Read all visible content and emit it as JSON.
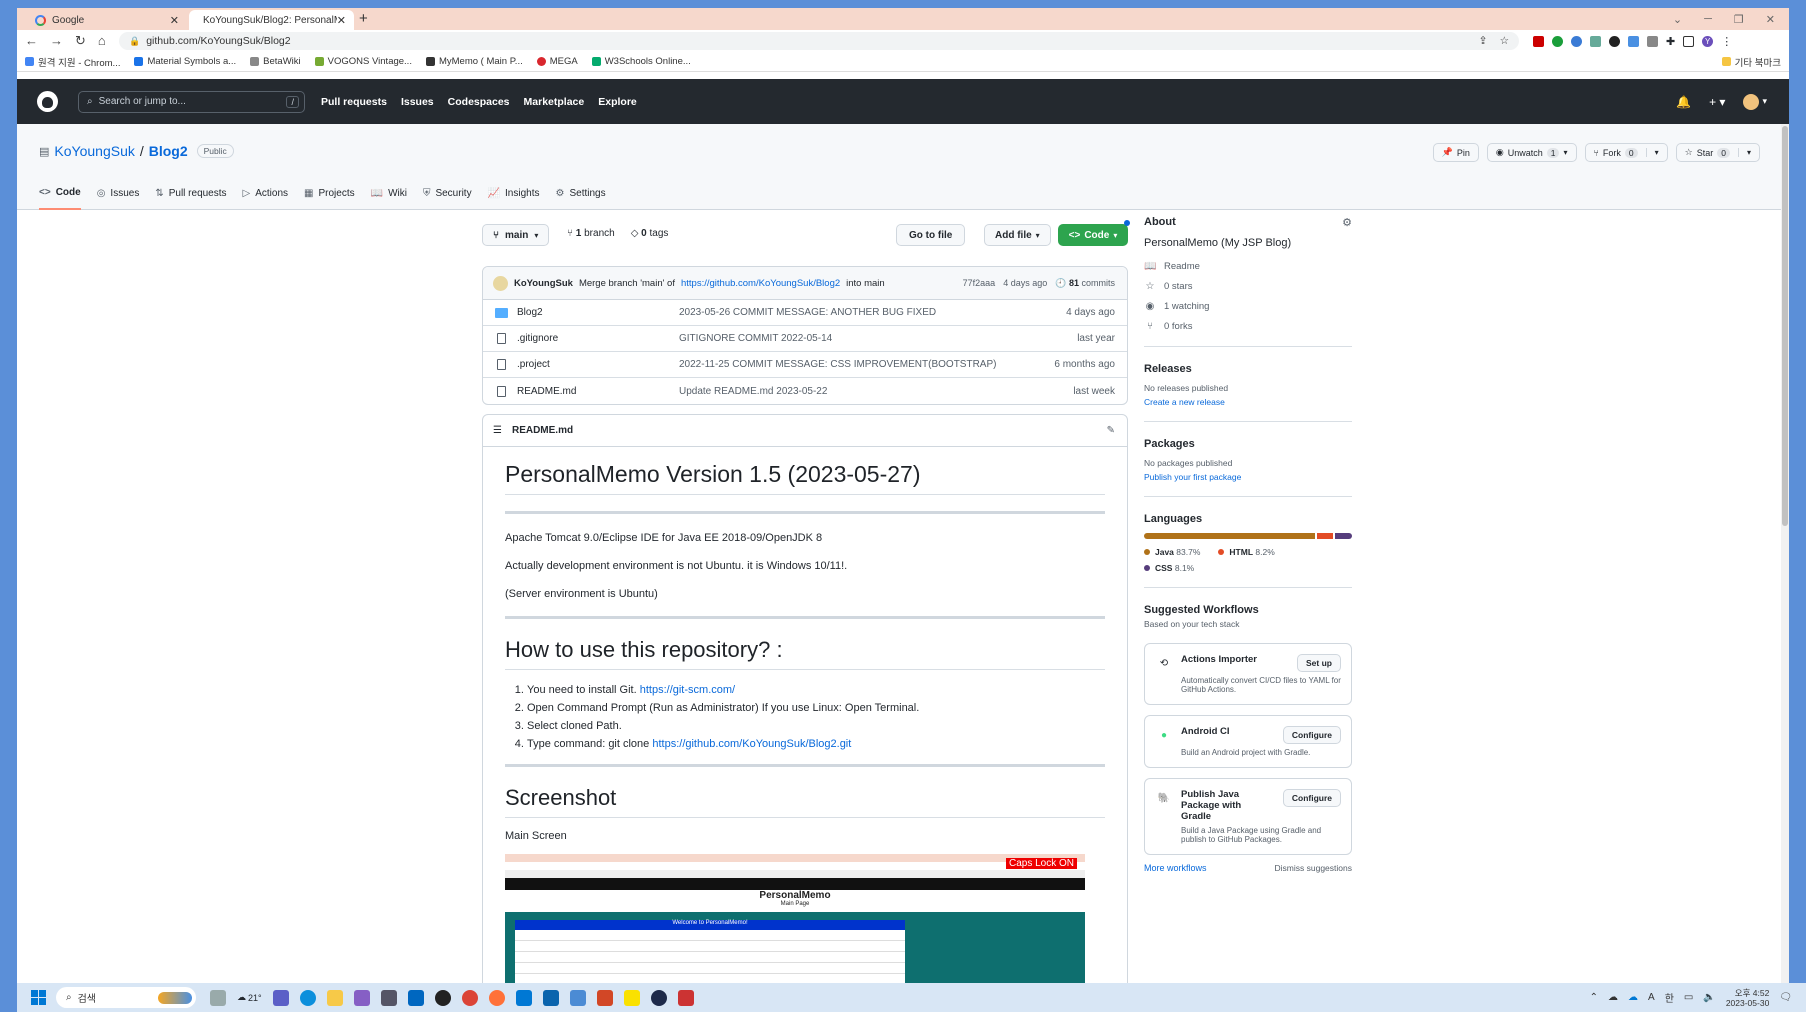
{
  "browser": {
    "tabs": [
      {
        "title": "Google"
      },
      {
        "title": "KoYoungSuk/Blog2: PersonalMe"
      }
    ],
    "url": "github.com/KoYoungSuk/Blog2",
    "bookmarks": [
      "원격 지원 - Chrom...",
      "Material Symbols a...",
      "BetaWiki",
      "VOGONS Vintage...",
      "MyMemo ( Main P...",
      "MEGA",
      "W3Schools Online..."
    ],
    "bookmarks_other": "기타 북마크"
  },
  "github": {
    "search_placeholder": "Search or jump to...",
    "search_shortcut": "/",
    "nav": [
      "Pull requests",
      "Issues",
      "Codespaces",
      "Marketplace",
      "Explore"
    ]
  },
  "repo": {
    "owner": "KoYoungSuk",
    "name": "Blog2",
    "visibility": "Public",
    "actions": {
      "pin": "Pin",
      "unwatch": "Unwatch",
      "unwatch_count": "1",
      "fork": "Fork",
      "fork_count": "0",
      "star": "Star",
      "star_count": "0"
    },
    "tabs": [
      "Code",
      "Issues",
      "Pull requests",
      "Actions",
      "Projects",
      "Wiki",
      "Security",
      "Insights",
      "Settings"
    ]
  },
  "code": {
    "branch": "main",
    "branch_count": "1",
    "branch_label": "branch",
    "tag_count": "0",
    "tag_label": "tags",
    "go_to_file": "Go to file",
    "add_file": "Add file",
    "code_button": "Code",
    "commit": {
      "author": "KoYoungSuk",
      "message_pre": "Merge branch 'main' of",
      "link": "https://github.com/KoYoungSuk/Blog2",
      "message_post": "into main",
      "hash": "77f2aaa",
      "age": "4 days ago",
      "count": "81",
      "count_label": "commits"
    },
    "files": [
      {
        "name": "Blog2",
        "type": "folder",
        "message": "2023-05-26 COMMIT MESSAGE: ANOTHER BUG FIXED",
        "age": "4 days ago"
      },
      {
        "name": ".gitignore",
        "type": "file",
        "message": "GITIGNORE COMMIT 2022-05-14",
        "age": "last year"
      },
      {
        "name": ".project",
        "type": "file",
        "message": "2022-11-25 COMMIT MESSAGE: CSS IMPROVEMENT(BOOTSTRAP)",
        "age": "6 months ago"
      },
      {
        "name": "README.md",
        "type": "file",
        "message": "Update README.md 2023-05-22",
        "age": "last week"
      }
    ]
  },
  "readme": {
    "filename": "README.md",
    "h1": "PersonalMemo Version 1.5 (2023-05-27)",
    "p1": "Apache Tomcat 9.0/Eclipse IDE for Java EE 2018-09/OpenJDK 8",
    "p2": "Actually development environment is not Ubuntu. it is Windows 10/11!.",
    "p3": "(Server environment is Ubuntu)",
    "h2_usage": "How to use this repository? :",
    "steps": [
      {
        "text": "You need to install Git.",
        "link": "https://git-scm.com/"
      },
      {
        "text": "Open Command Prompt (Run as Administrator) If you use Linux: Open Terminal.",
        "link": ""
      },
      {
        "text": "Select cloned Path.",
        "link": ""
      },
      {
        "text": "Type command: git clone",
        "link": "https://github.com/KoYoungSuk/Blog2.git"
      }
    ],
    "h2_screenshot": "Screenshot",
    "main_screen": "Main Screen",
    "screenshot_caps": "Caps Lock ON",
    "screenshot_title": "PersonalMemo",
    "screenshot_subtitle": "Main Page",
    "screenshot_welcome": "Welcome to PersonalMemo!"
  },
  "sidebar": {
    "about_title": "About",
    "description": "PersonalMemo (My JSP Blog)",
    "readme": "Readme",
    "stars": "0 stars",
    "watching": "1 watching",
    "forks": "0 forks",
    "releases_title": "Releases",
    "releases_none": "No releases published",
    "releases_link": "Create a new release",
    "packages_title": "Packages",
    "packages_none": "No packages published",
    "packages_link": "Publish your first package",
    "languages_title": "Languages",
    "languages": [
      {
        "name": "Java",
        "percent": "83.7%",
        "value": 83.7,
        "color": "#b07219"
      },
      {
        "name": "HTML",
        "percent": "8.2%",
        "value": 8.2,
        "color": "#e34c26"
      },
      {
        "name": "CSS",
        "percent": "8.1%",
        "value": 8.1,
        "color": "#563d7c"
      }
    ],
    "workflows_title": "Suggested Workflows",
    "workflows_sub": "Based on your tech stack",
    "workflows": [
      {
        "name": "Actions Importer",
        "button": "Set up",
        "desc": "Automatically convert CI/CD files to YAML for GitHub Actions."
      },
      {
        "name": "Android CI",
        "button": "Configure",
        "desc": "Build an Android project with Gradle."
      },
      {
        "name": "Publish Java Package with Gradle",
        "button": "Configure",
        "desc": "Build a Java Package using Gradle and publish to GitHub Packages."
      }
    ],
    "more_workflows": "More workflows",
    "dismiss": "Dismiss suggestions"
  },
  "taskbar": {
    "search": "검색",
    "weather": "21°",
    "time": "오후 4:52",
    "date": "2023-05-30"
  }
}
